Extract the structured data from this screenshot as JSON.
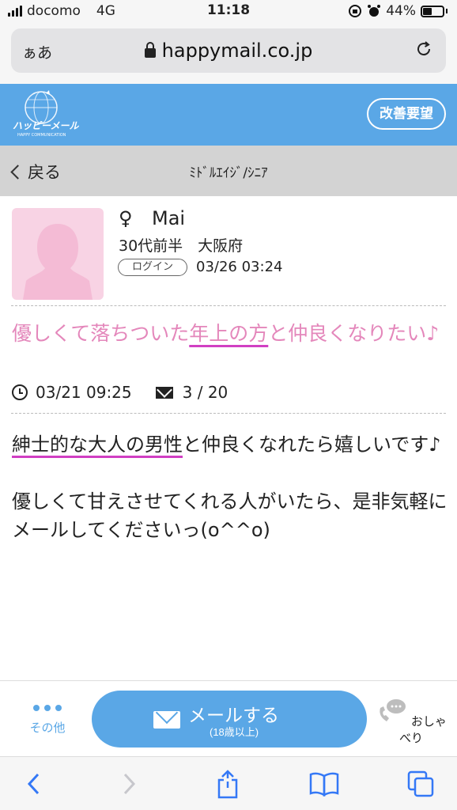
{
  "status_bar": {
    "carrier": "docomo",
    "network": "4G",
    "time": "11:18",
    "battery": "44%"
  },
  "browser": {
    "text_size_button": "ぁあ",
    "url": "happymail.co.jp"
  },
  "header": {
    "logo_text": "ハッピーメール",
    "logo_subtext": "HAPPY COMMUNICATION",
    "improve_button": "改善要望"
  },
  "nav": {
    "back_label": "戻る",
    "title": "ﾐﾄﾞﾙｴｲｼﾞ/ｼﾆｱ"
  },
  "profile": {
    "gender_symbol": "♀",
    "name": "Mai",
    "age_area": "30代前半　大阪府",
    "login_badge": "ログイン",
    "login_time": "03/26 03:24"
  },
  "post": {
    "title_part1": "優しくて落ちついた",
    "title_highlight": "年上の方",
    "title_part2": "と仲良くなりたい♪",
    "posted_time": "03/21 09:25",
    "mail_count": "3 / 20",
    "body_highlight": "紳士的な大人の男性",
    "body_line1_rest": "と仲良くなれたら嬉しいです♪",
    "body_line2": "優しくて甘えさせてくれる人がいたら、是非気軽にメールしてくださいっ(o^^o)"
  },
  "actions": {
    "other_label": "その他",
    "mail_button_label": "メールする",
    "mail_button_sub": "(18歳以上)",
    "chat_label": "おしゃべり"
  },
  "colors": {
    "brand_blue": "#5aa7e6",
    "title_pink": "#e487bb",
    "underline_magenta": "#d13fc3",
    "avatar_pink": "#f8d3e4"
  }
}
